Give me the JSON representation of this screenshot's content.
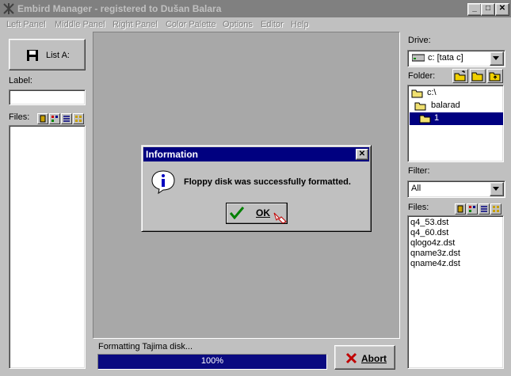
{
  "window": {
    "title": "Embird Manager - registered to Dušan Balara",
    "controls": [
      "_",
      "□",
      "✕"
    ]
  },
  "menu": [
    "Left Panel",
    "Middle Panel",
    "Right Panel",
    "Color Palette",
    "Options",
    "Editor",
    "Help"
  ],
  "left_panel": {
    "list_button_label": "List A:",
    "label_caption": "Label:",
    "label_value": "",
    "files_caption": "Files:"
  },
  "right_panel": {
    "drive_caption": "Drive:",
    "drive_value": "c: [tata c]",
    "folder_caption": "Folder:",
    "folders": [
      "c:\\",
      "balarad",
      "1"
    ],
    "selected_folder": "1",
    "filter_caption": "Filter:",
    "filter_value": "All",
    "files_caption": "Files:",
    "files": [
      "q4_53.dst",
      "q4_60.dst",
      "qlogo4z.dst",
      "qname3z.dst",
      "qname4z.dst"
    ]
  },
  "status": {
    "message": "Formatting Tajima disk...",
    "progress_text": "100%",
    "progress_value": 1.0,
    "abort_label": "Abort"
  },
  "dialog": {
    "title": "Information",
    "message": "Floppy disk was successfully formatted.",
    "ok_label": "OK"
  },
  "colors": {
    "title_active": "#000080",
    "title_inactive": "#808080",
    "face": "#c0c0c0",
    "workspace": "#a8a8a8",
    "abort_x": "#c00000",
    "ok_check": "#008000"
  }
}
